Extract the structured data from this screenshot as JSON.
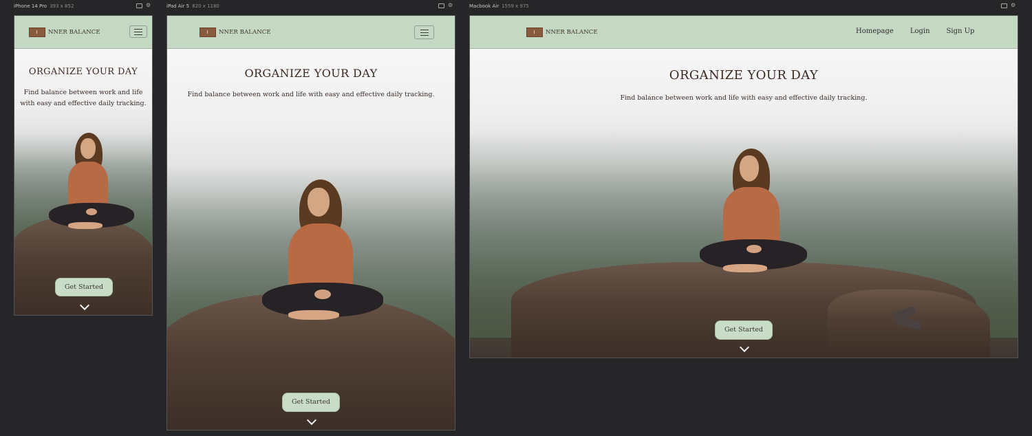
{
  "devices": [
    {
      "id": "iphone",
      "name": "iPhone 14 Pro",
      "dims": "393 x 852",
      "brand": "NNER BALANCE",
      "nav_type": "hamburger",
      "hero": {
        "title": "ORGANIZE YOUR DAY",
        "subtitle": "Find balance between work and life with easy and effective daily tracking.",
        "cta": "Get Started"
      }
    },
    {
      "id": "ipad",
      "name": "iPad Air 5",
      "dims": "820 x 1180",
      "brand": "NNER BALANCE",
      "nav_type": "hamburger",
      "hero": {
        "title": "ORGANIZE YOUR DAY",
        "subtitle": "Find balance between work and life with easy and effective daily tracking.",
        "cta": "Get Started"
      }
    },
    {
      "id": "macbook",
      "name": "Macbook Air",
      "dims": "1559 x 975",
      "brand": "NNER BALANCE",
      "nav_type": "links",
      "nav_links": [
        "Homepage",
        "Login",
        "Sign Up"
      ],
      "hero": {
        "title": "ORGANIZE YOUR DAY",
        "subtitle": "Find balance between work and life with easy and effective daily tracking.",
        "cta": "Get Started"
      }
    }
  ],
  "colors": {
    "background": "#262628",
    "navbar": "#c5d8c4",
    "cta": "#c9dcc8",
    "title_text": "#3b2a22",
    "logo_badge": "#8a5a3e"
  },
  "icons": {
    "menu": "hamburger-icon",
    "scroll": "chevron-down-icon",
    "device_toggle": "rotate-icon",
    "device_settings": "gear-icon"
  }
}
